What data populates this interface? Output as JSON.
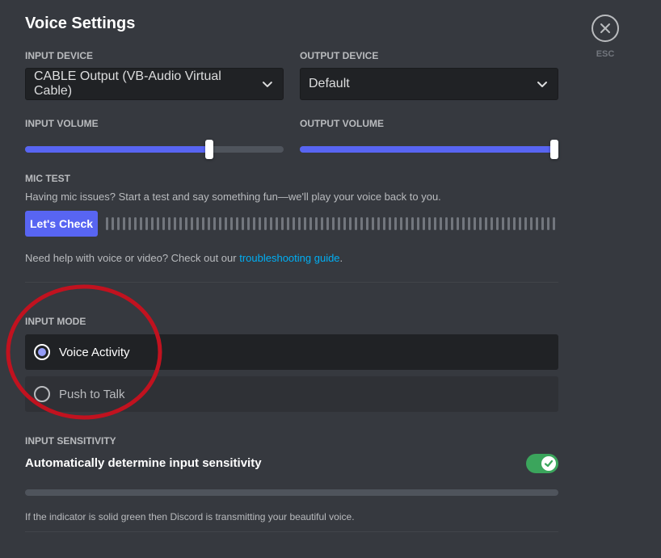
{
  "page_title": "Voice Settings",
  "close": {
    "label": "ESC"
  },
  "input_device": {
    "label": "INPUT DEVICE",
    "value": "CABLE Output (VB-Audio Virtual Cable)"
  },
  "output_device": {
    "label": "OUTPUT DEVICE",
    "value": "Default"
  },
  "input_volume": {
    "label": "INPUT VOLUME",
    "level_percent": 72
  },
  "output_volume": {
    "label": "OUTPUT VOLUME",
    "level_percent": 100
  },
  "mic_test": {
    "label": "MIC TEST",
    "description": "Having mic issues? Start a test and say something fun—we'll play your voice back to you.",
    "button_label": "Let's Check"
  },
  "help": {
    "prefix": "Need help with voice or video? Check out our ",
    "link_text": "troubleshooting guide",
    "suffix": "."
  },
  "input_mode": {
    "label": "INPUT MODE",
    "options": [
      {
        "label": "Voice Activity",
        "selected": true
      },
      {
        "label": "Push to Talk",
        "selected": false
      }
    ]
  },
  "input_sensitivity": {
    "label": "INPUT SENSITIVITY",
    "auto_label": "Automatically determine input sensitivity",
    "auto_enabled": true,
    "note": "If the indicator is solid green then Discord is transmitting your beautiful voice."
  },
  "colors": {
    "background": "#36393f",
    "accent": "#5865f2",
    "toggle_on": "#3ba55c",
    "link": "#00aff4",
    "annotation": "#c1121f"
  },
  "icons": {
    "close": "close-icon",
    "dropdown": "chevron-down-icon",
    "toggle_check": "check-icon"
  }
}
